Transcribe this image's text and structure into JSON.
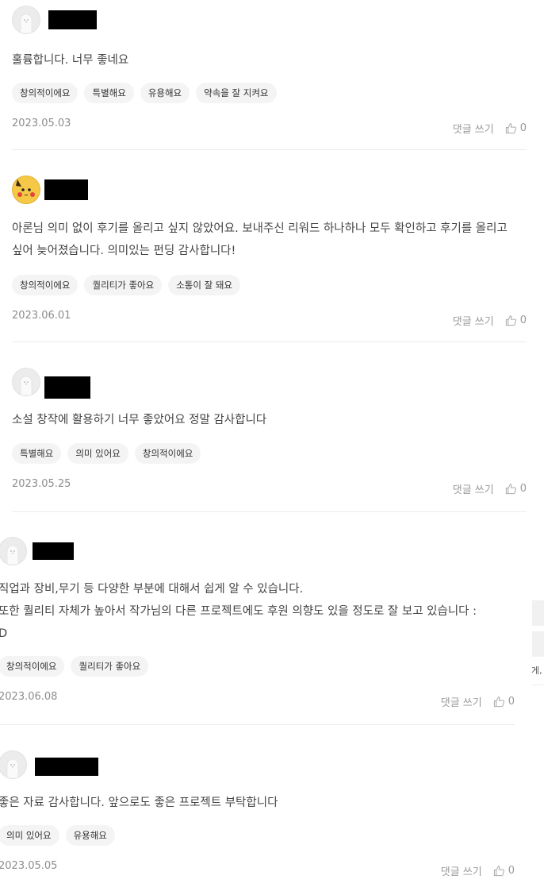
{
  "reviews": [
    {
      "text": "훌륭합니다. 너무 좋네요",
      "tags": [
        "창의적이에요",
        "특별해요",
        "유용해요",
        "약속을 잘 지켜요"
      ],
      "date": "2023.05.03",
      "comment_label": "댓글 쓰기",
      "likes": "0",
      "avatar": "default-avatar-icon"
    },
    {
      "text": "아론님 의미 없이 후기를 올리고 싶지 않았어요. 보내주신 리워드 하나하나 모두 확인하고 후기를 올리고 싶어 늦어졌습니다. 의미있는 펀딩 감사합니다!",
      "tags": [
        "창의적이에요",
        "퀄리티가 좋아요",
        "소통이 잘 돼요"
      ],
      "date": "2023.06.01",
      "comment_label": "댓글 쓰기",
      "likes": "0",
      "avatar": "character-avatar-icon"
    },
    {
      "text": "소설 창작에 활용하기 너무 좋았어요 정말 감사합니다",
      "tags": [
        "특별해요",
        "의미 있어요",
        "창의적이에요"
      ],
      "date": "2023.05.25",
      "comment_label": "댓글 쓰기",
      "likes": "0",
      "avatar": "default-avatar-icon"
    },
    {
      "text": "직업과 장비,무기 등 다양한 부분에 대해서 쉽게 알 수 있습니다.\n또한 퀄리티 자체가 높아서 작가님의 다른 프로젝트에도 후원 의향도 있을 정도로 잘 보고 있습니다 :\nD",
      "tags": [
        "창의적이에요",
        "퀄리티가 좋아요"
      ],
      "date": "2023.06.08",
      "comment_label": "댓글 쓰기",
      "likes": "0",
      "avatar": "default-avatar-icon"
    },
    {
      "text": "좋은 자료 감사합니다. 앞으로도 좋은 프로젝트 부탁합니다",
      "tags": [
        "의미 있어요",
        "유용해요"
      ],
      "date": "2023.05.05",
      "comment_label": "댓글 쓰기",
      "likes": "0",
      "avatar": "default-avatar-icon"
    }
  ],
  "side_fragment": "게,",
  "colors": {
    "redaction": "#000000",
    "tag_bg": "#f4f4f4",
    "meta_text": "#8c8c8c"
  }
}
